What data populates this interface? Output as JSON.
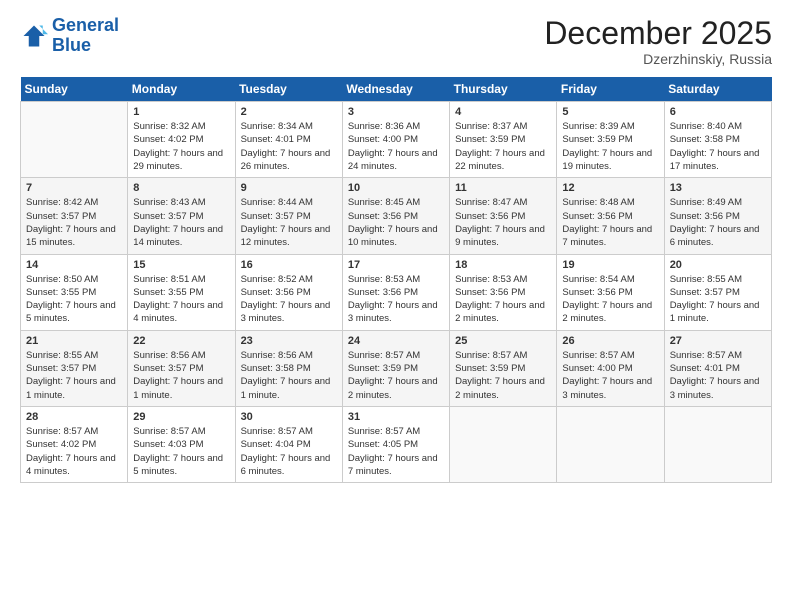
{
  "logo": {
    "line1": "General",
    "line2": "Blue"
  },
  "title": "December 2025",
  "location": "Dzerzhinskiy, Russia",
  "weekdays": [
    "Sunday",
    "Monday",
    "Tuesday",
    "Wednesday",
    "Thursday",
    "Friday",
    "Saturday"
  ],
  "weeks": [
    [
      {
        "day": "",
        "sunrise": "",
        "sunset": "",
        "daylight": ""
      },
      {
        "day": "1",
        "sunrise": "Sunrise: 8:32 AM",
        "sunset": "Sunset: 4:02 PM",
        "daylight": "Daylight: 7 hours and 29 minutes."
      },
      {
        "day": "2",
        "sunrise": "Sunrise: 8:34 AM",
        "sunset": "Sunset: 4:01 PM",
        "daylight": "Daylight: 7 hours and 26 minutes."
      },
      {
        "day": "3",
        "sunrise": "Sunrise: 8:36 AM",
        "sunset": "Sunset: 4:00 PM",
        "daylight": "Daylight: 7 hours and 24 minutes."
      },
      {
        "day": "4",
        "sunrise": "Sunrise: 8:37 AM",
        "sunset": "Sunset: 3:59 PM",
        "daylight": "Daylight: 7 hours and 22 minutes."
      },
      {
        "day": "5",
        "sunrise": "Sunrise: 8:39 AM",
        "sunset": "Sunset: 3:59 PM",
        "daylight": "Daylight: 7 hours and 19 minutes."
      },
      {
        "day": "6",
        "sunrise": "Sunrise: 8:40 AM",
        "sunset": "Sunset: 3:58 PM",
        "daylight": "Daylight: 7 hours and 17 minutes."
      }
    ],
    [
      {
        "day": "7",
        "sunrise": "Sunrise: 8:42 AM",
        "sunset": "Sunset: 3:57 PM",
        "daylight": "Daylight: 7 hours and 15 minutes."
      },
      {
        "day": "8",
        "sunrise": "Sunrise: 8:43 AM",
        "sunset": "Sunset: 3:57 PM",
        "daylight": "Daylight: 7 hours and 14 minutes."
      },
      {
        "day": "9",
        "sunrise": "Sunrise: 8:44 AM",
        "sunset": "Sunset: 3:57 PM",
        "daylight": "Daylight: 7 hours and 12 minutes."
      },
      {
        "day": "10",
        "sunrise": "Sunrise: 8:45 AM",
        "sunset": "Sunset: 3:56 PM",
        "daylight": "Daylight: 7 hours and 10 minutes."
      },
      {
        "day": "11",
        "sunrise": "Sunrise: 8:47 AM",
        "sunset": "Sunset: 3:56 PM",
        "daylight": "Daylight: 7 hours and 9 minutes."
      },
      {
        "day": "12",
        "sunrise": "Sunrise: 8:48 AM",
        "sunset": "Sunset: 3:56 PM",
        "daylight": "Daylight: 7 hours and 7 minutes."
      },
      {
        "day": "13",
        "sunrise": "Sunrise: 8:49 AM",
        "sunset": "Sunset: 3:56 PM",
        "daylight": "Daylight: 7 hours and 6 minutes."
      }
    ],
    [
      {
        "day": "14",
        "sunrise": "Sunrise: 8:50 AM",
        "sunset": "Sunset: 3:55 PM",
        "daylight": "Daylight: 7 hours and 5 minutes."
      },
      {
        "day": "15",
        "sunrise": "Sunrise: 8:51 AM",
        "sunset": "Sunset: 3:55 PM",
        "daylight": "Daylight: 7 hours and 4 minutes."
      },
      {
        "day": "16",
        "sunrise": "Sunrise: 8:52 AM",
        "sunset": "Sunset: 3:56 PM",
        "daylight": "Daylight: 7 hours and 3 minutes."
      },
      {
        "day": "17",
        "sunrise": "Sunrise: 8:53 AM",
        "sunset": "Sunset: 3:56 PM",
        "daylight": "Daylight: 7 hours and 3 minutes."
      },
      {
        "day": "18",
        "sunrise": "Sunrise: 8:53 AM",
        "sunset": "Sunset: 3:56 PM",
        "daylight": "Daylight: 7 hours and 2 minutes."
      },
      {
        "day": "19",
        "sunrise": "Sunrise: 8:54 AM",
        "sunset": "Sunset: 3:56 PM",
        "daylight": "Daylight: 7 hours and 2 minutes."
      },
      {
        "day": "20",
        "sunrise": "Sunrise: 8:55 AM",
        "sunset": "Sunset: 3:57 PM",
        "daylight": "Daylight: 7 hours and 1 minute."
      }
    ],
    [
      {
        "day": "21",
        "sunrise": "Sunrise: 8:55 AM",
        "sunset": "Sunset: 3:57 PM",
        "daylight": "Daylight: 7 hours and 1 minute."
      },
      {
        "day": "22",
        "sunrise": "Sunrise: 8:56 AM",
        "sunset": "Sunset: 3:57 PM",
        "daylight": "Daylight: 7 hours and 1 minute."
      },
      {
        "day": "23",
        "sunrise": "Sunrise: 8:56 AM",
        "sunset": "Sunset: 3:58 PM",
        "daylight": "Daylight: 7 hours and 1 minute."
      },
      {
        "day": "24",
        "sunrise": "Sunrise: 8:57 AM",
        "sunset": "Sunset: 3:59 PM",
        "daylight": "Daylight: 7 hours and 2 minutes."
      },
      {
        "day": "25",
        "sunrise": "Sunrise: 8:57 AM",
        "sunset": "Sunset: 3:59 PM",
        "daylight": "Daylight: 7 hours and 2 minutes."
      },
      {
        "day": "26",
        "sunrise": "Sunrise: 8:57 AM",
        "sunset": "Sunset: 4:00 PM",
        "daylight": "Daylight: 7 hours and 3 minutes."
      },
      {
        "day": "27",
        "sunrise": "Sunrise: 8:57 AM",
        "sunset": "Sunset: 4:01 PM",
        "daylight": "Daylight: 7 hours and 3 minutes."
      }
    ],
    [
      {
        "day": "28",
        "sunrise": "Sunrise: 8:57 AM",
        "sunset": "Sunset: 4:02 PM",
        "daylight": "Daylight: 7 hours and 4 minutes."
      },
      {
        "day": "29",
        "sunrise": "Sunrise: 8:57 AM",
        "sunset": "Sunset: 4:03 PM",
        "daylight": "Daylight: 7 hours and 5 minutes."
      },
      {
        "day": "30",
        "sunrise": "Sunrise: 8:57 AM",
        "sunset": "Sunset: 4:04 PM",
        "daylight": "Daylight: 7 hours and 6 minutes."
      },
      {
        "day": "31",
        "sunrise": "Sunrise: 8:57 AM",
        "sunset": "Sunset: 4:05 PM",
        "daylight": "Daylight: 7 hours and 7 minutes."
      },
      {
        "day": "",
        "sunrise": "",
        "sunset": "",
        "daylight": ""
      },
      {
        "day": "",
        "sunrise": "",
        "sunset": "",
        "daylight": ""
      },
      {
        "day": "",
        "sunrise": "",
        "sunset": "",
        "daylight": ""
      }
    ]
  ]
}
